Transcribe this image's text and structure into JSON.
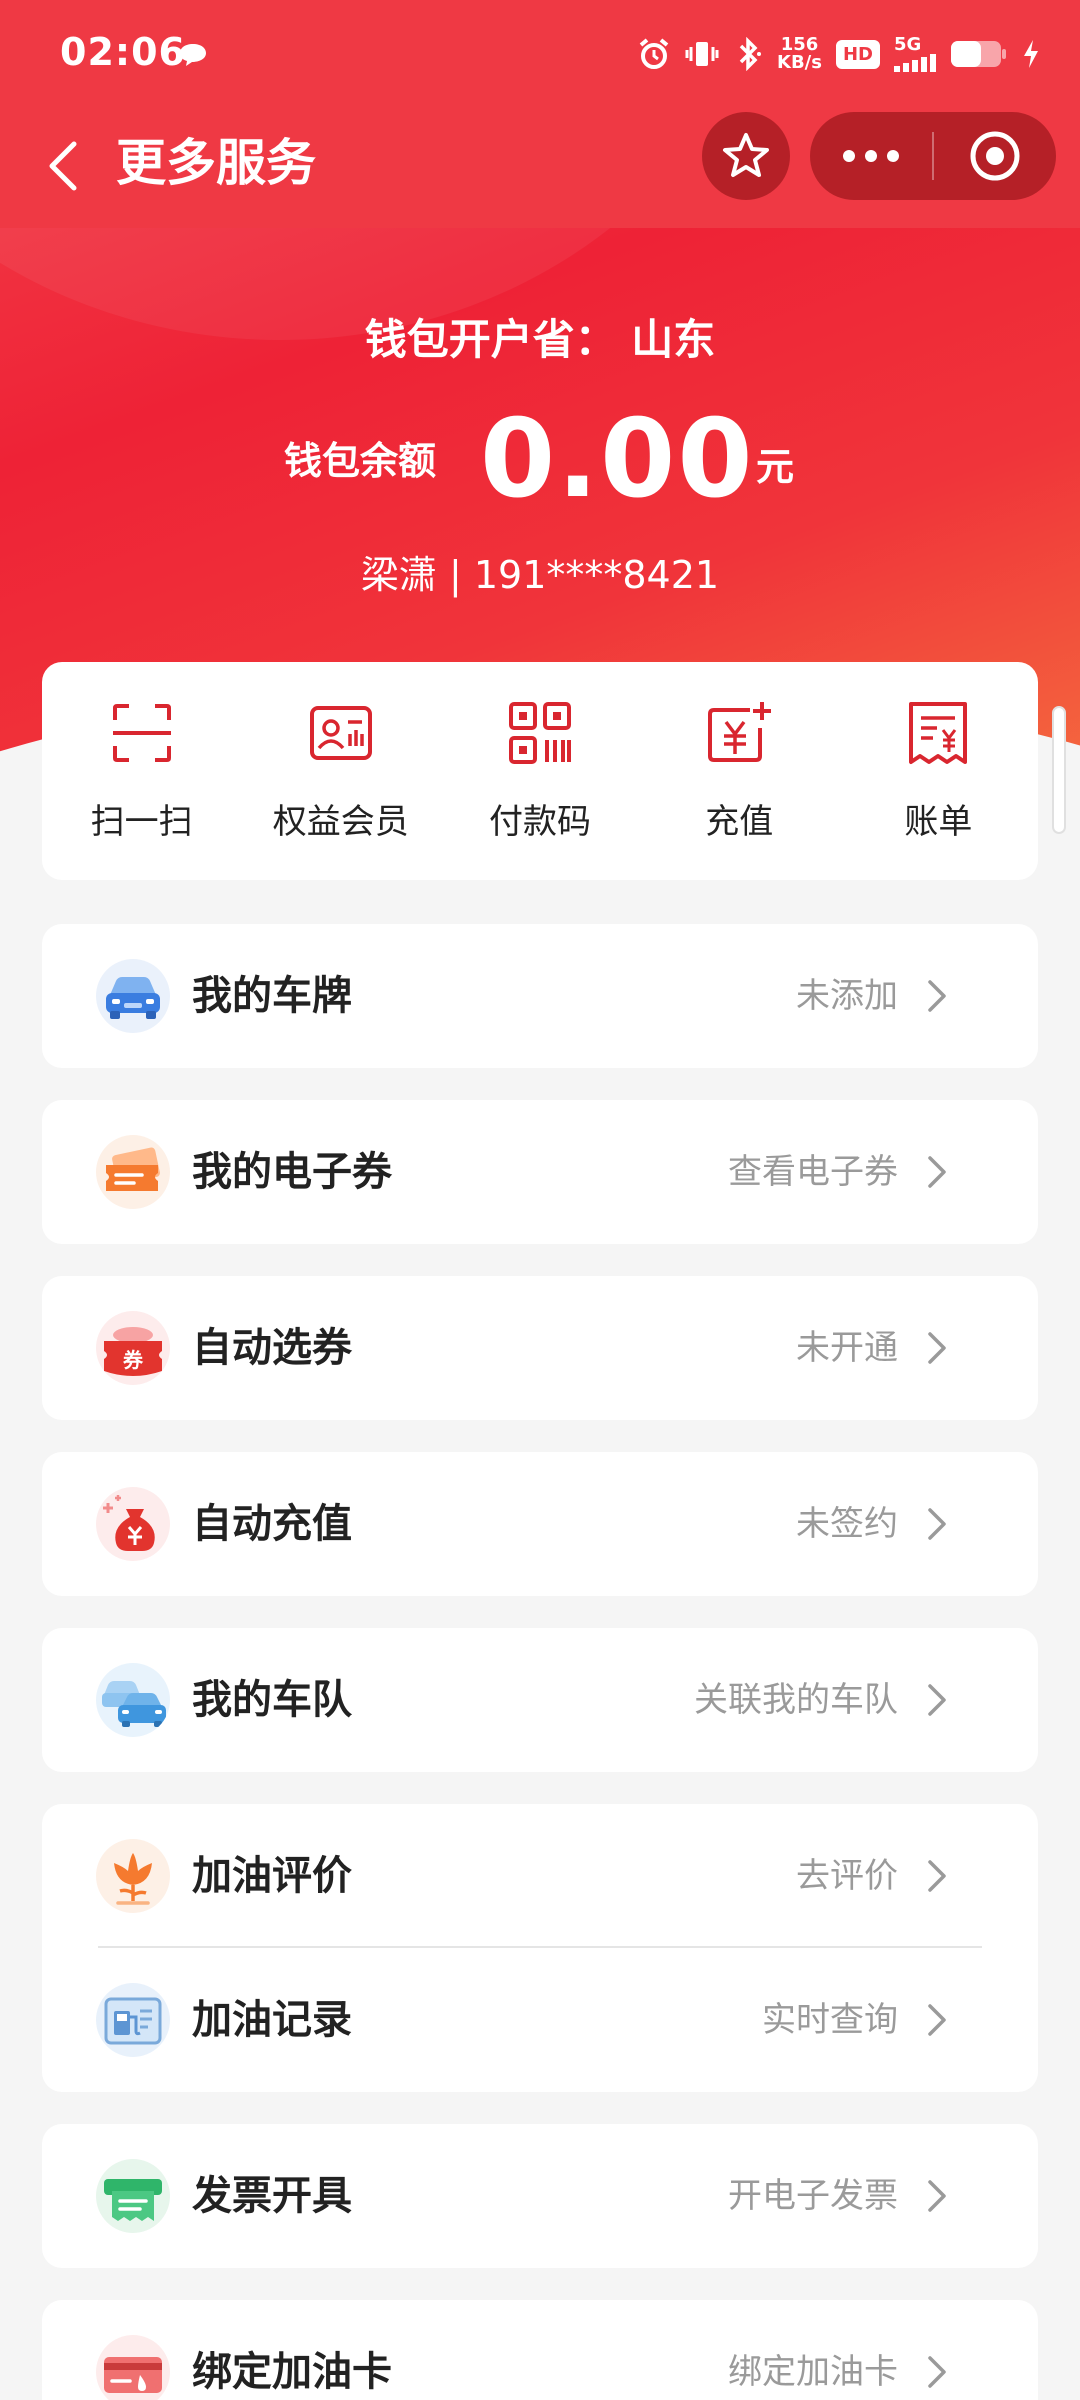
{
  "status_bar": {
    "time": "02:06",
    "net_speed_top": "156",
    "net_speed_bottom": "KB/s",
    "hd": "HD",
    "network": "5G"
  },
  "nav": {
    "title": "更多服务"
  },
  "wallet": {
    "province_text": "钱包开户省： 山东",
    "balance_label": "钱包余额",
    "balance_value": "0.00",
    "balance_unit": "元",
    "user_text": "梁潇 | 191****8421"
  },
  "actions": [
    {
      "label": "扫一扫",
      "icon": "scan-icon"
    },
    {
      "label": "权益会员",
      "icon": "member-card-icon"
    },
    {
      "label": "付款码",
      "icon": "qr-code-icon"
    },
    {
      "label": "充值",
      "icon": "recharge-icon"
    },
    {
      "label": "账单",
      "icon": "bill-icon"
    }
  ],
  "services": [
    {
      "title": "我的车牌",
      "value": "未添加",
      "icon": "car-icon"
    },
    {
      "title": "我的电子券",
      "value": "查看电子券",
      "icon": "ticket-icon"
    },
    {
      "title": "自动选券",
      "value": "未开通",
      "icon": "coupon-icon"
    },
    {
      "title": "自动充值",
      "value": "未签约",
      "icon": "money-bag-icon"
    },
    {
      "title": "我的车队",
      "value": "关联我的车队",
      "icon": "fleet-icon"
    },
    {
      "title": "加油评价",
      "value": "去评价",
      "icon": "flower-icon"
    },
    {
      "title": "加油记录",
      "value": "实时查询",
      "icon": "fuel-record-icon"
    },
    {
      "title": "发票开具",
      "value": "开电子发票",
      "icon": "invoice-icon"
    },
    {
      "title": "绑定加油卡",
      "value": "绑定加油卡",
      "icon": "fuel-card-icon"
    }
  ],
  "colors": {
    "brand_red": "#ef3944",
    "icon_red": "#d9262f",
    "text_dark": "#222222",
    "text_gray": "#9a9a9a"
  }
}
